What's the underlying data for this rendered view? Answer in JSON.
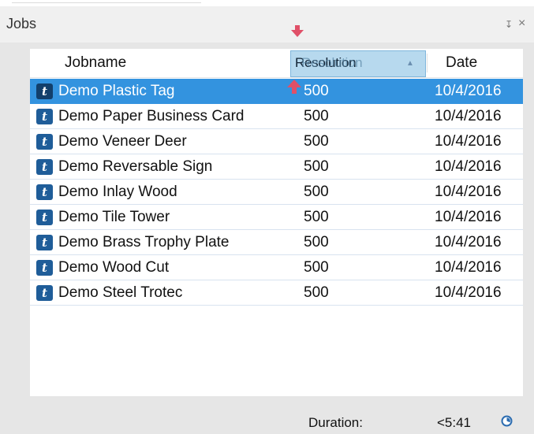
{
  "panel": {
    "title": "Jobs",
    "pin_icon": "pin-icon",
    "close_icon": "close-icon",
    "pin_glyph": "↧",
    "close_glyph": "×"
  },
  "table": {
    "columns": {
      "jobname": "Jobname",
      "resolution": "Resolution",
      "date": "Date"
    },
    "rows": [
      {
        "name": "Demo Plastic Tag",
        "resolution": "500",
        "date": "10/4/2016",
        "icon_label": "t",
        "selected": true
      },
      {
        "name": "Demo Paper Business Card",
        "resolution": "500",
        "date": "10/4/2016",
        "icon_label": "t",
        "selected": false
      },
      {
        "name": "Demo Veneer Deer",
        "resolution": "500",
        "date": "10/4/2016",
        "icon_label": "t",
        "selected": false
      },
      {
        "name": "Demo Reversable Sign",
        "resolution": "500",
        "date": "10/4/2016",
        "icon_label": "t",
        "selected": false
      },
      {
        "name": "Demo Inlay Wood",
        "resolution": "500",
        "date": "10/4/2016",
        "icon_label": "t",
        "selected": false
      },
      {
        "name": "Demo Tile Tower",
        "resolution": "500",
        "date": "10/4/2016",
        "icon_label": "t",
        "selected": false
      },
      {
        "name": "Demo Brass Trophy Plate",
        "resolution": "500",
        "date": "10/4/2016",
        "icon_label": "t",
        "selected": false
      },
      {
        "name": "Demo Wood Cut",
        "resolution": "500",
        "date": "10/4/2016",
        "icon_label": "t",
        "selected": false
      },
      {
        "name": "Demo Steel Trotec",
        "resolution": "500",
        "date": "10/4/2016",
        "icon_label": "t",
        "selected": false
      }
    ]
  },
  "footer": {
    "duration_label": "Duration:",
    "duration_value": "<5:41",
    "timer_icon": "timer-icon"
  },
  "colors": {
    "selection": "#3393df",
    "job_icon": "#1f5d99",
    "drag_indicator": "#e05068",
    "header_drag_highlight": "#b7d9ee"
  }
}
